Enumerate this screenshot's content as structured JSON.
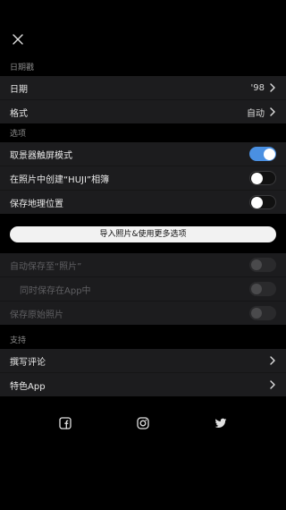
{
  "sections": {
    "date": {
      "label": "日期戳",
      "rows": [
        {
          "label": "日期",
          "value": "'98"
        },
        {
          "label": "格式",
          "value": "自动"
        }
      ]
    },
    "options": {
      "label": "选项",
      "rows": [
        {
          "label": "取景器触屏模式",
          "state": "on"
        },
        {
          "label": "在照片中创建“HUJI”相簿",
          "state": "off"
        },
        {
          "label": "保存地理位置",
          "state": "off"
        }
      ]
    },
    "import_button": "导入照片&使用更多选项",
    "locked": {
      "rows": [
        {
          "label": "自动保存至“照片”"
        },
        {
          "label": "同时保存在App中"
        },
        {
          "label": "保存原始照片"
        }
      ]
    },
    "support": {
      "label": "支持",
      "rows": [
        {
          "label": "撰写评论"
        },
        {
          "label": "特色App"
        }
      ]
    }
  },
  "icons": {
    "close": "close-icon",
    "chevron": "chevron-right-icon",
    "facebook": "facebook-icon",
    "instagram": "instagram-icon",
    "twitter": "twitter-icon"
  },
  "colors": {
    "accent": "#4a90e2",
    "background": "#000000",
    "group": "#1c1c1e"
  }
}
